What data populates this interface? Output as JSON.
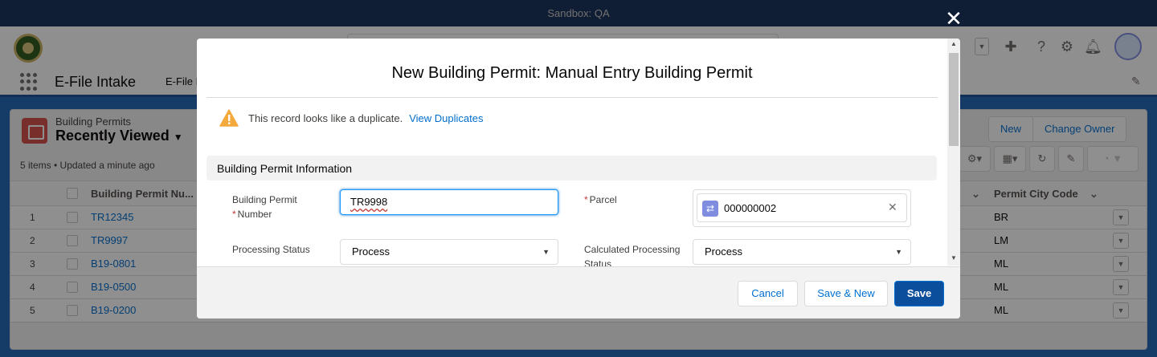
{
  "sandbox_label": "Sandbox: QA",
  "nav": {
    "app_name": "E-File Intake",
    "item_partial": "E-File I"
  },
  "list_view": {
    "object_label": "Building Permits",
    "title": "Recently Viewed",
    "meta": "5 items • Updated a minute ago",
    "buttons": [
      "New",
      "Change Owner"
    ],
    "columns": [
      "Building Permit Nu...",
      "Permit City Code"
    ],
    "rows": [
      {
        "num": "1",
        "permit": "TR12345",
        "city": "BR"
      },
      {
        "num": "2",
        "permit": "TR9997",
        "city": "LM"
      },
      {
        "num": "3",
        "permit": "B19-0801",
        "city": "ML"
      },
      {
        "num": "4",
        "permit": "B19-0500",
        "city": "ML"
      },
      {
        "num": "5",
        "permit": "B19-0200",
        "city": "ML"
      }
    ]
  },
  "modal": {
    "title": "New Building Permit: Manual Entry Building Permit",
    "duplicate_text": "This record looks like a duplicate.",
    "duplicate_link": "View Duplicates",
    "section_title": "Building Permit Information",
    "fields": {
      "permit_number_label_line1": "Building Permit",
      "permit_number_label_line2": "Number",
      "permit_number_value": "TR9998",
      "parcel_label": "Parcel",
      "parcel_value": "000000002",
      "processing_status_label": "Processing Status",
      "processing_status_value": "Process",
      "calc_status_label_line1": "Calculated Processing",
      "calc_status_label_line2": "Status",
      "calc_status_value": "Process"
    },
    "footer": {
      "cancel": "Cancel",
      "save_new": "Save & New",
      "save": "Save"
    }
  },
  "colors": {
    "brand": "#0b4f9c",
    "link": "#006dcc",
    "warning": "#f4a93d",
    "required": "#c23934"
  }
}
